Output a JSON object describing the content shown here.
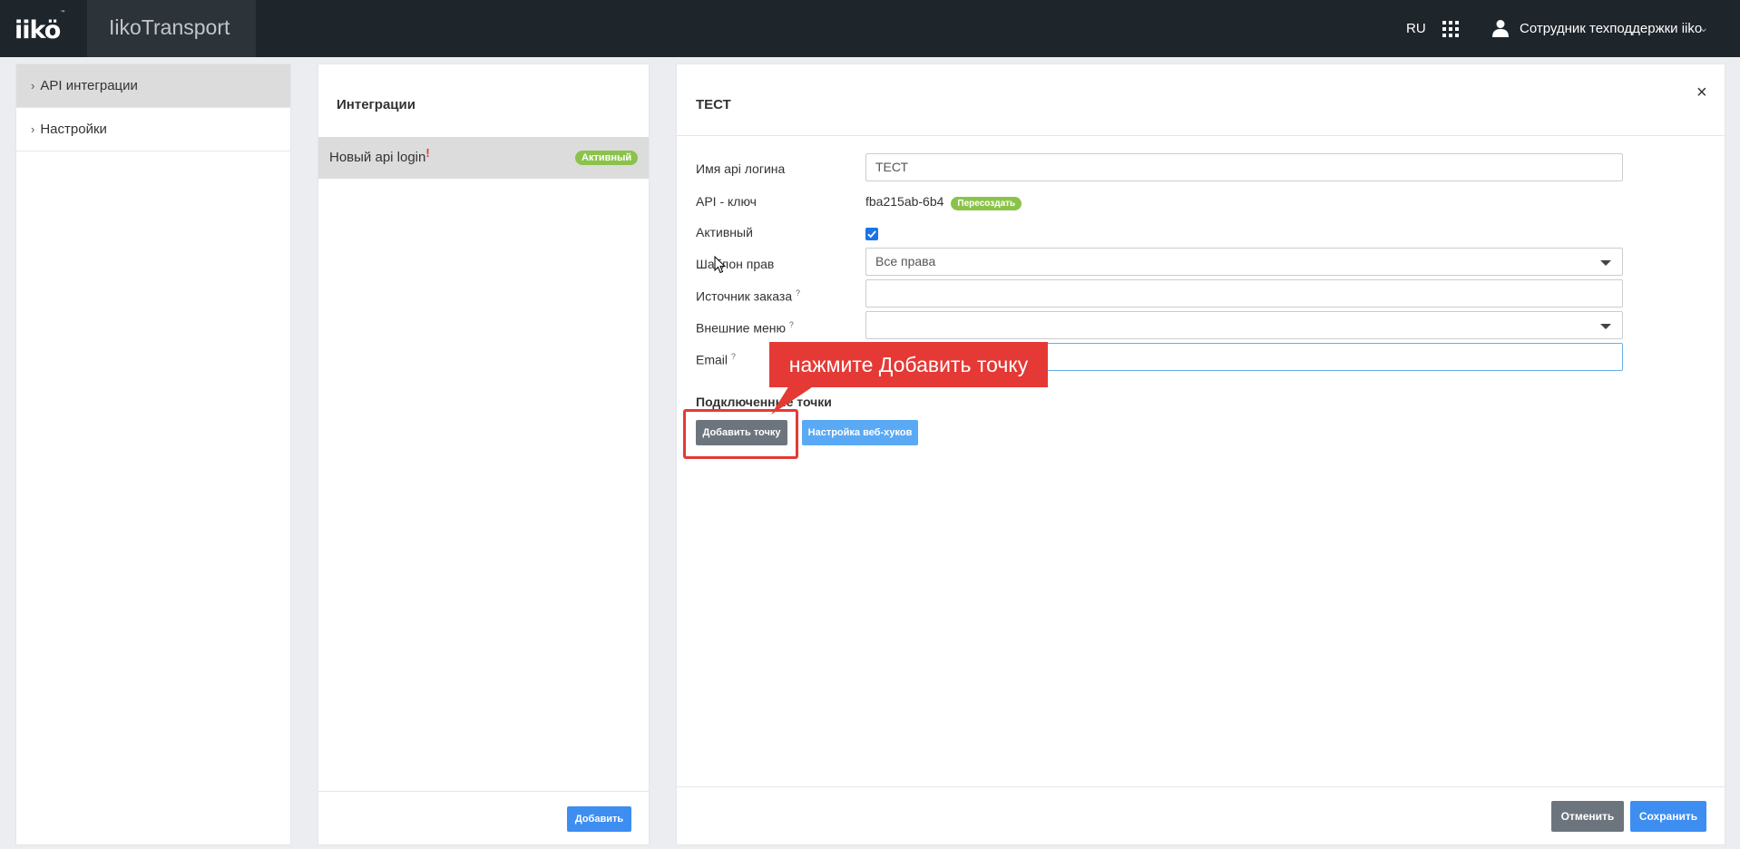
{
  "header": {
    "logo": "iikö",
    "logo_tm": "™",
    "app_title": "IikoTransport",
    "lang": "RU",
    "user_name": "Сотрудник техподдержки iiko",
    "icons": [
      "apps-grid-icon",
      "user-icon",
      "chevron-down-icon"
    ]
  },
  "sidebar": {
    "items": [
      {
        "label": "API интеграции",
        "active": true
      },
      {
        "label": "Настройки",
        "active": false
      }
    ]
  },
  "integrations": {
    "title": "Интеграции",
    "items": [
      {
        "label": "Новый api login",
        "alert": "!",
        "status": "Активный"
      }
    ],
    "add_button": "Добавить"
  },
  "detail": {
    "title": "ТЕСТ",
    "close": "×",
    "fields": {
      "login_name": {
        "label": "Имя api логина",
        "value": "ТЕСТ"
      },
      "api_key": {
        "label": "API - ключ",
        "value": "fba215ab-6b4",
        "regen_label": "Пересоздать"
      },
      "active": {
        "label": "Активный",
        "checked": true
      },
      "rights_template": {
        "label": "Шаблон прав",
        "value": "Все права"
      },
      "order_source": {
        "label": "Источник заказа",
        "hint": "?",
        "value": ""
      },
      "external_menu": {
        "label": "Внешние меню",
        "hint": "?",
        "value": ""
      },
      "email": {
        "label": "Email",
        "hint": "?",
        "value": ""
      }
    },
    "connected_points": {
      "title": "Подключенные точки",
      "add_point_button": "Добавить точку",
      "webhooks_button": "Настройка веб-хуков"
    },
    "cancel_button": "Отменить",
    "save_button": "Сохранить"
  },
  "annotation": {
    "callout_text": "нажмите Добавить точку",
    "color": "#e53935"
  },
  "colors": {
    "header_bg": "#1e252b",
    "accent_blue": "#3d8ef0",
    "status_green": "#8bc34a"
  }
}
